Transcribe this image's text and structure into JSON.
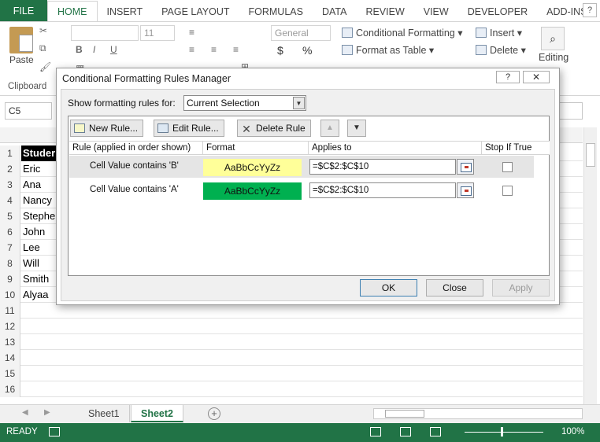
{
  "ribbon": {
    "tabs": [
      "FILE",
      "HOME",
      "INSERT",
      "PAGE LAYOUT",
      "FORMULAS",
      "DATA",
      "REVIEW",
      "VIEW",
      "DEVELOPER",
      "ADD-INS"
    ],
    "active_tab": "HOME",
    "paste_label": "Paste",
    "clipboard_label": "Clipboard",
    "font_size": "11",
    "number_format": "General",
    "currency_symbol": "$",
    "percent_symbol": "%",
    "conditional_formatting": "Conditional Formatting",
    "format_as_table": "Format as Table",
    "insert": "Insert",
    "delete": "Delete",
    "editing": "Editing",
    "window_help": "?"
  },
  "formula_bar": {
    "name_box": "C5"
  },
  "sheet": {
    "row_numbers": [
      "1",
      "2",
      "3",
      "4",
      "5",
      "6",
      "7",
      "8",
      "9",
      "10",
      "11",
      "12",
      "13",
      "14",
      "15",
      "16"
    ],
    "column_a": [
      "Studer",
      "Eric",
      "Ana",
      "Nancy",
      "Stephe",
      "John",
      "Lee",
      "Will",
      "Smith",
      "Alyaa",
      "",
      "",
      "",
      "",
      "",
      ""
    ]
  },
  "sheet_tabs": {
    "tab1": "Sheet1",
    "tab2": "Sheet2",
    "active": "Sheet2"
  },
  "status_bar": {
    "ready": "READY",
    "zoom": "100%"
  },
  "dialog": {
    "title": "Conditional Formatting Rules Manager",
    "show_rules_label": "Show formatting rules for:",
    "show_rules_value": "Current Selection",
    "buttons": {
      "new_rule": "New Rule...",
      "edit_rule": "Edit Rule...",
      "delete_rule": "Delete Rule",
      "ok": "OK",
      "close": "Close",
      "apply": "Apply"
    },
    "columns": {
      "rule": "Rule (applied in order shown)",
      "format": "Format",
      "applies_to": "Applies to",
      "stop_if_true": "Stop If True"
    },
    "rules": [
      {
        "rule": "Cell Value contains 'B'",
        "format_preview": "AaBbCcYyZz",
        "format_color": "#ffff99",
        "applies_to": "=$C$2:$C$10",
        "stop_if_true": false
      },
      {
        "rule": "Cell Value contains 'A'",
        "format_preview": "AaBbCcYyZz",
        "format_color": "#00b050",
        "applies_to": "=$C$2:$C$10",
        "stop_if_true": false
      }
    ]
  },
  "colors": {
    "excel_green": "#217346",
    "rule1_fill": "#ffff99",
    "rule2_fill": "#00b050"
  }
}
